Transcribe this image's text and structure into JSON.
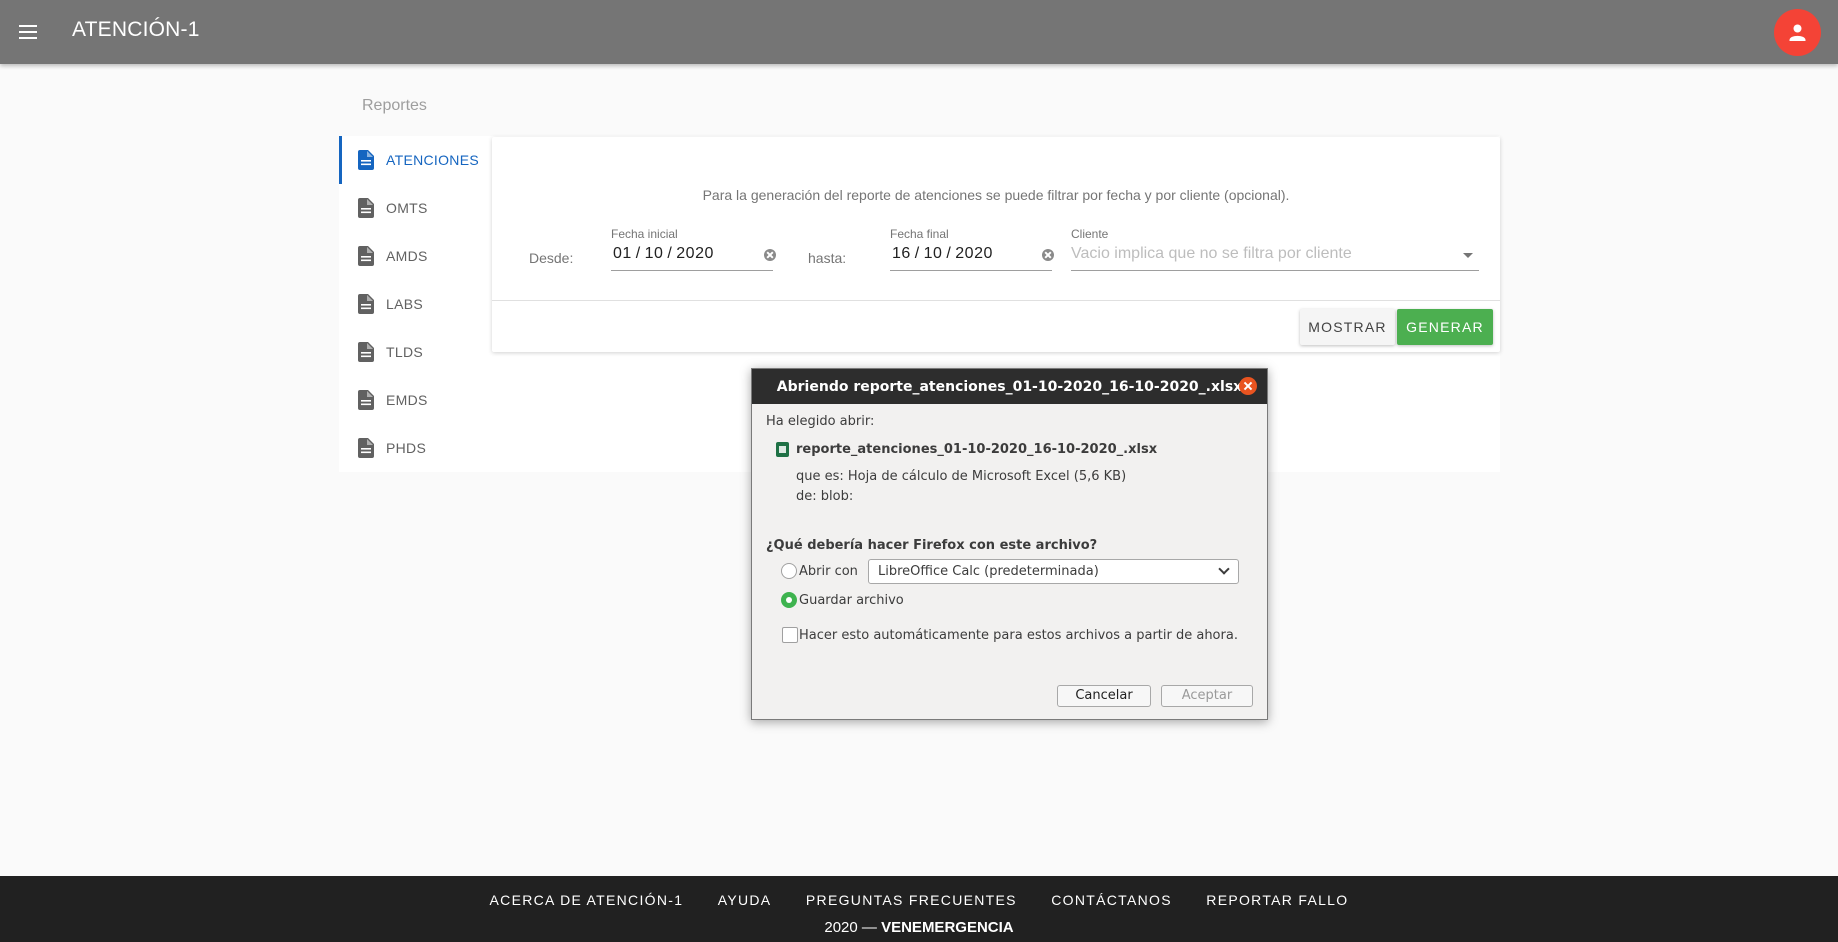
{
  "app": {
    "title": "ATENCIÓN-1"
  },
  "section": {
    "title": "Reportes"
  },
  "sidebar": {
    "items": [
      {
        "label": "ATENCIONES",
        "active": true
      },
      {
        "label": "OMTS",
        "active": false
      },
      {
        "label": "AMDS",
        "active": false
      },
      {
        "label": "LABS",
        "active": false
      },
      {
        "label": "TLDS",
        "active": false
      },
      {
        "label": "EMDS",
        "active": false
      },
      {
        "label": "PHDS",
        "active": false
      }
    ]
  },
  "report_form": {
    "description": "Para la generación del reporte de atenciones se puede filtrar por fecha y por cliente (opcional).",
    "desde_label": "Desde:",
    "hasta_label": "hasta:",
    "fecha_inicial": {
      "label": "Fecha inicial",
      "value": "01 / 10 / 2020"
    },
    "fecha_final": {
      "label": "Fecha final",
      "value": "16 / 10 / 2020"
    },
    "cliente": {
      "label": "Cliente",
      "placeholder": "Vacio implica que no se filtra por cliente"
    },
    "mostrar_label": "MOSTRAR",
    "generar_label": "GENERAR"
  },
  "dialog": {
    "title": "Abriendo reporte_atenciones_01-10-2020_16-10-2020_.xlsx",
    "chosen_label": "Ha elegido abrir:",
    "file_name": "reporte_atenciones_01-10-2020_16-10-2020_.xlsx",
    "file_type": "que es: Hoja de cálculo de Microsoft Excel (5,6 KB)",
    "file_from": "de: blob:",
    "question": "¿Qué debería hacer Firefox con este archivo?",
    "open_with_label": "Abrir con",
    "open_with_app": "LibreOffice Calc (predeterminada)",
    "save_label": "Guardar archivo",
    "selected_option": "save",
    "auto_label": "Hacer esto automáticamente para estos archivos a partir de ahora.",
    "auto_checked": false,
    "cancel_label": "Cancelar",
    "accept_label": "Aceptar"
  },
  "footer": {
    "links": [
      "ACERCA DE ATENCIÓN-1",
      "AYUDA",
      "PREGUNTAS FRECUENTES",
      "CONTÁCTANOS",
      "REPORTAR FALLO"
    ],
    "copy_prefix": "2020 —",
    "copy_brand": "VENEMERGENCIA"
  },
  "colors": {
    "appbar": "#757575",
    "accent": "#1565c0",
    "avatar": "#f44336",
    "generate": "#4caf50",
    "dialog_close": "#e95420",
    "radio_checked": "#3eb34f",
    "footer": "#212121"
  },
  "icons": {
    "menu": "menu-icon",
    "avatar": "account-icon",
    "nav": "description-icon",
    "clear": "clear-circle-icon",
    "dropdown": "arrow-drop-down-icon",
    "dialog_close": "close-icon",
    "file": "spreadsheet-file-icon"
  }
}
